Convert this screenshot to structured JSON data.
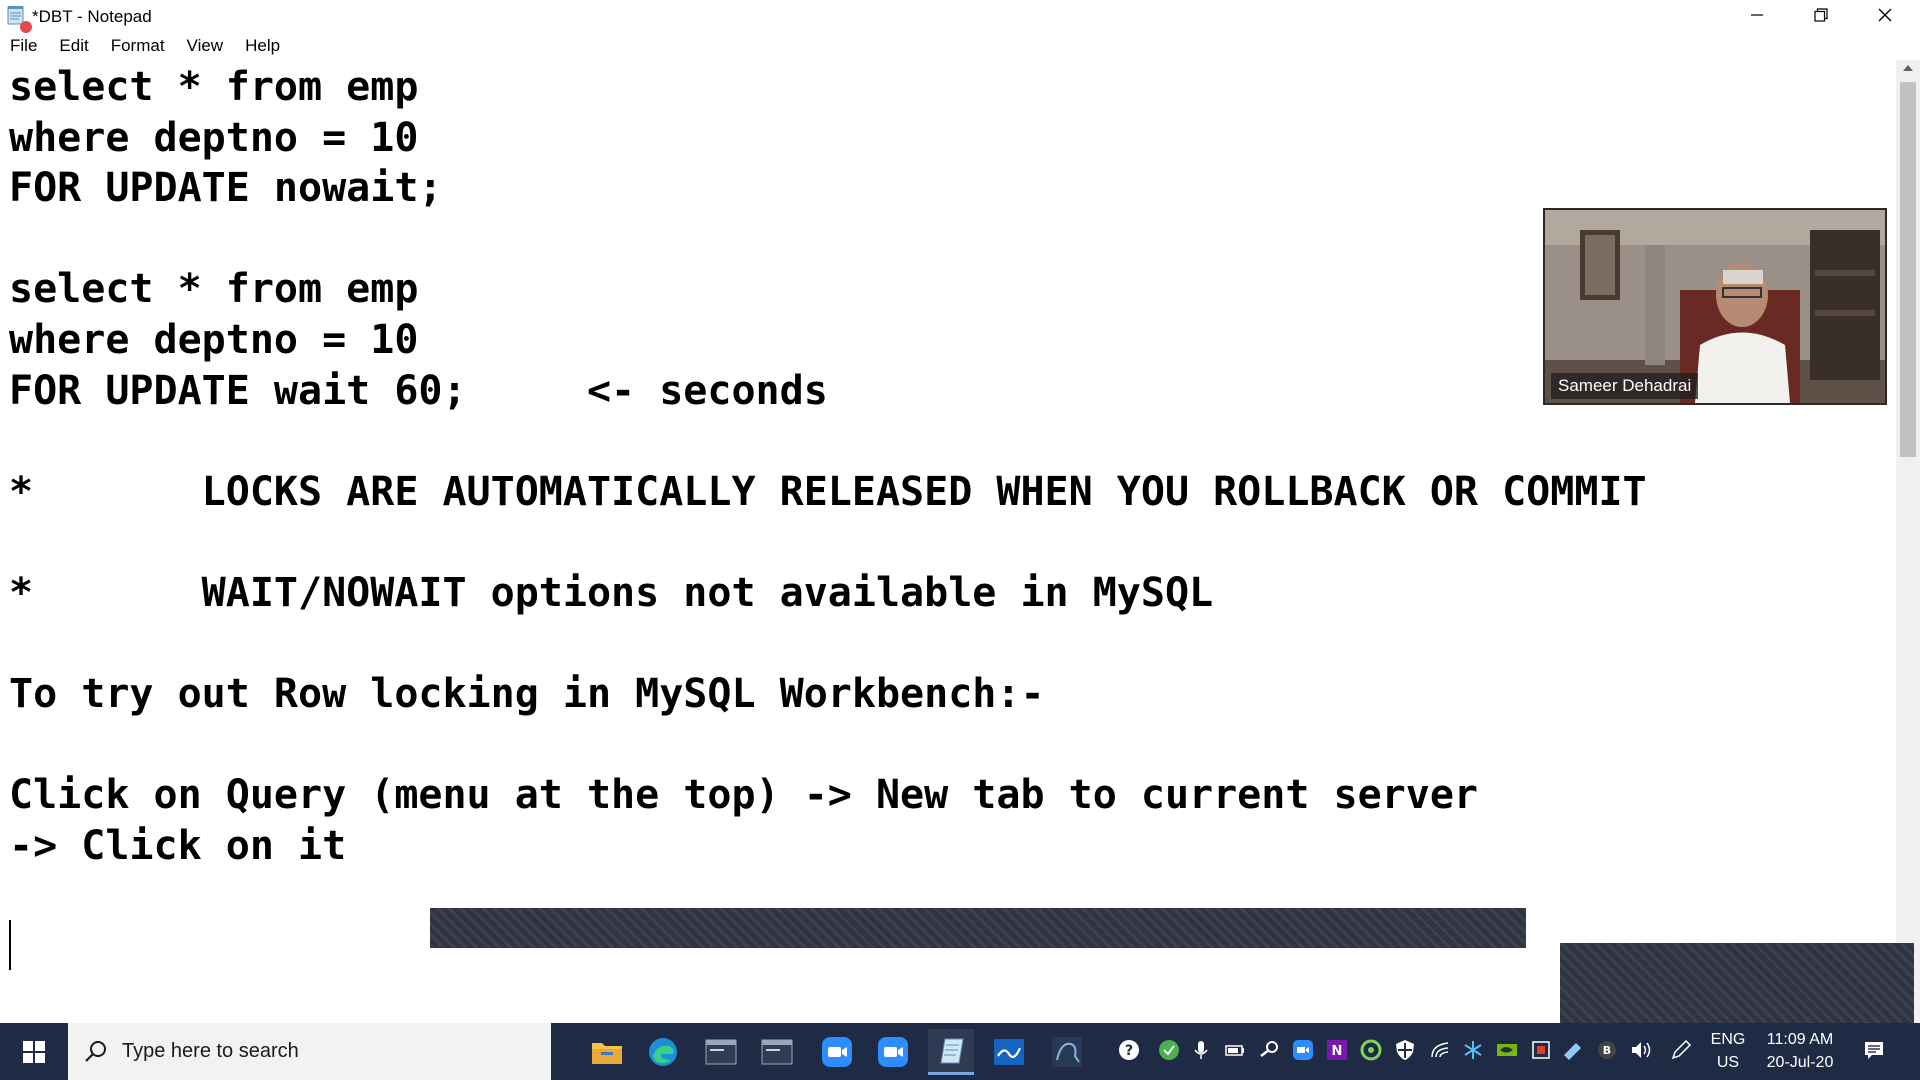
{
  "window": {
    "title": "*DBT - Notepad"
  },
  "menu": {
    "items": [
      {
        "label": "File"
      },
      {
        "label": "Edit"
      },
      {
        "label": "Format"
      },
      {
        "label": "View"
      },
      {
        "label": "Help"
      }
    ]
  },
  "editor": {
    "content": "select * from emp\nwhere deptno = 10\nFOR UPDATE nowait;\n\nselect * from emp\nwhere deptno = 10\nFOR UPDATE wait 60;     <- seconds\n\n*       LOCKS ARE AUTOMATICALLY RELEASED WHEN YOU ROLLBACK OR COMMIT\n\n*       WAIT/NOWAIT options not available in MySQL\n\nTo try out Row locking in MySQL Workbench:-\n\nClick on Query (menu at the top) -> New tab to current server\n-> Click on it"
  },
  "video": {
    "participant_name": "Sameer Dehadrai"
  },
  "taskbar": {
    "search_placeholder": "Type here to search",
    "language_line1": "ENG",
    "language_line2": "US",
    "time": "11:09 AM",
    "date": "20-Jul-20"
  },
  "colors": {
    "taskbar": "#1f2a44",
    "recording": "#e04b4b",
    "overlay": "#2e3440"
  }
}
